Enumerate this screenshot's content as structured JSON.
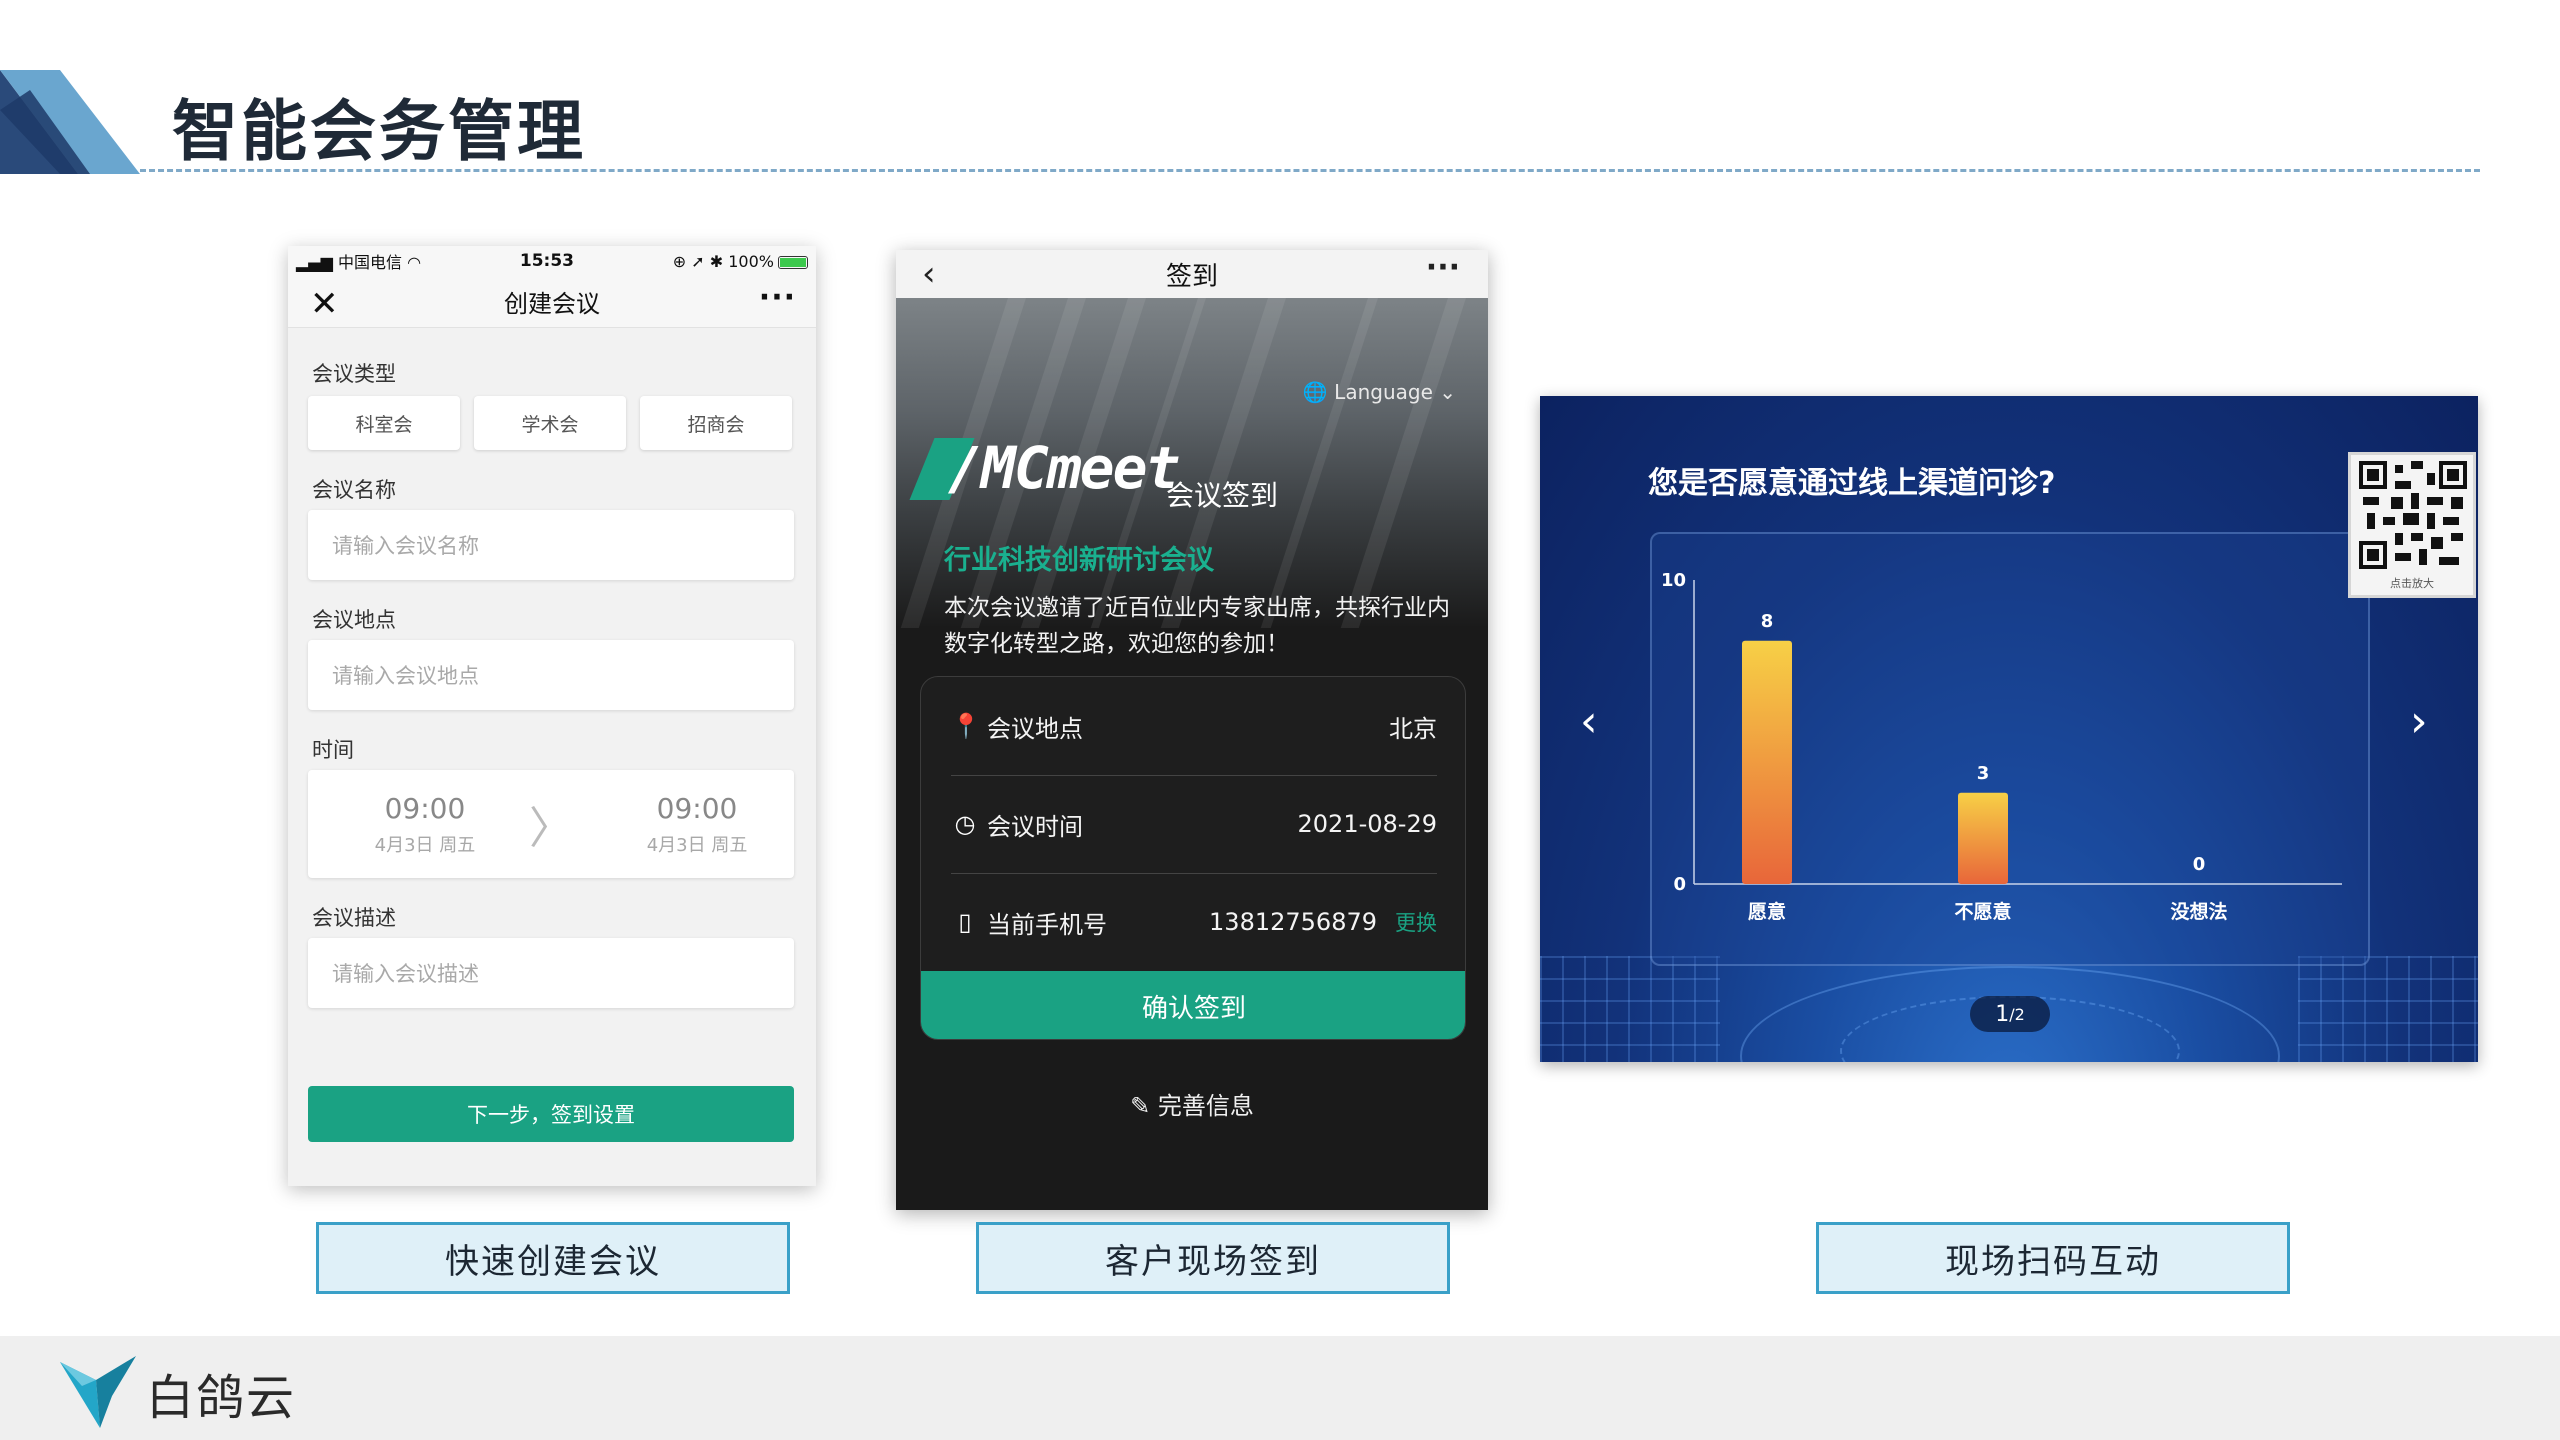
{
  "page": {
    "title": "智能会务管理",
    "brand": "白鸽云"
  },
  "captions": {
    "create": "快速创建会议",
    "checkin": "客户现场签到",
    "interact": "现场扫码互动"
  },
  "phone_create": {
    "status": {
      "carrier": "中国电信",
      "time": "15:53",
      "battery": "100%"
    },
    "nav_title": "创建会议",
    "labels": {
      "type": "会议类型",
      "name": "会议名称",
      "location": "会议地点",
      "time": "时间",
      "desc": "会议描述"
    },
    "types": [
      "科室会",
      "学术会",
      "招商会"
    ],
    "placeholders": {
      "name": "请输入会议名称",
      "location": "请输入会议地点",
      "desc": "请输入会议描述"
    },
    "time": {
      "start_time": "09:00",
      "start_date": "4月3日 周五",
      "end_time": "09:00",
      "end_date": "4月3日 周五"
    },
    "next_button": "下一步，签到设置"
  },
  "phone_checkin": {
    "nav_title": "签到",
    "language": "Language",
    "logo_text": "Cmeet",
    "logo_sub": "会议签到",
    "conference_title": "行业科技创新研讨会议",
    "conference_desc": "本次会议邀请了近百位业内专家出席，共探行业内数字化转型之路，欢迎您的参加！",
    "rows": {
      "location_label": "会议地点",
      "location_value": "北京",
      "time_label": "会议时间",
      "time_value": "2021-08-29",
      "phone_label": "当前手机号",
      "phone_value": "13812756879",
      "change": "更换"
    },
    "confirm_button": "确认签到",
    "complete_info": "完善信息"
  },
  "interaction_screen": {
    "question": "您是否愿意通过线上渠道问诊?",
    "qr_caption": "点击放大",
    "page_current": "1",
    "page_total": "/2"
  },
  "chart_data": {
    "type": "bar",
    "categories": [
      "愿意",
      "不愿意",
      "没想法"
    ],
    "values": [
      8,
      3,
      0
    ],
    "ylim": [
      0,
      10
    ],
    "yticks": [
      0,
      10
    ],
    "data_labels": true,
    "bar_gradient": [
      "#f7d046",
      "#e8663a"
    ],
    "axis_color": "#c8d4ea"
  },
  "colors": {
    "accent_green": "#1aa283",
    "caption_border": "#3aa0c8",
    "caption_fill": "#dff0f8"
  }
}
